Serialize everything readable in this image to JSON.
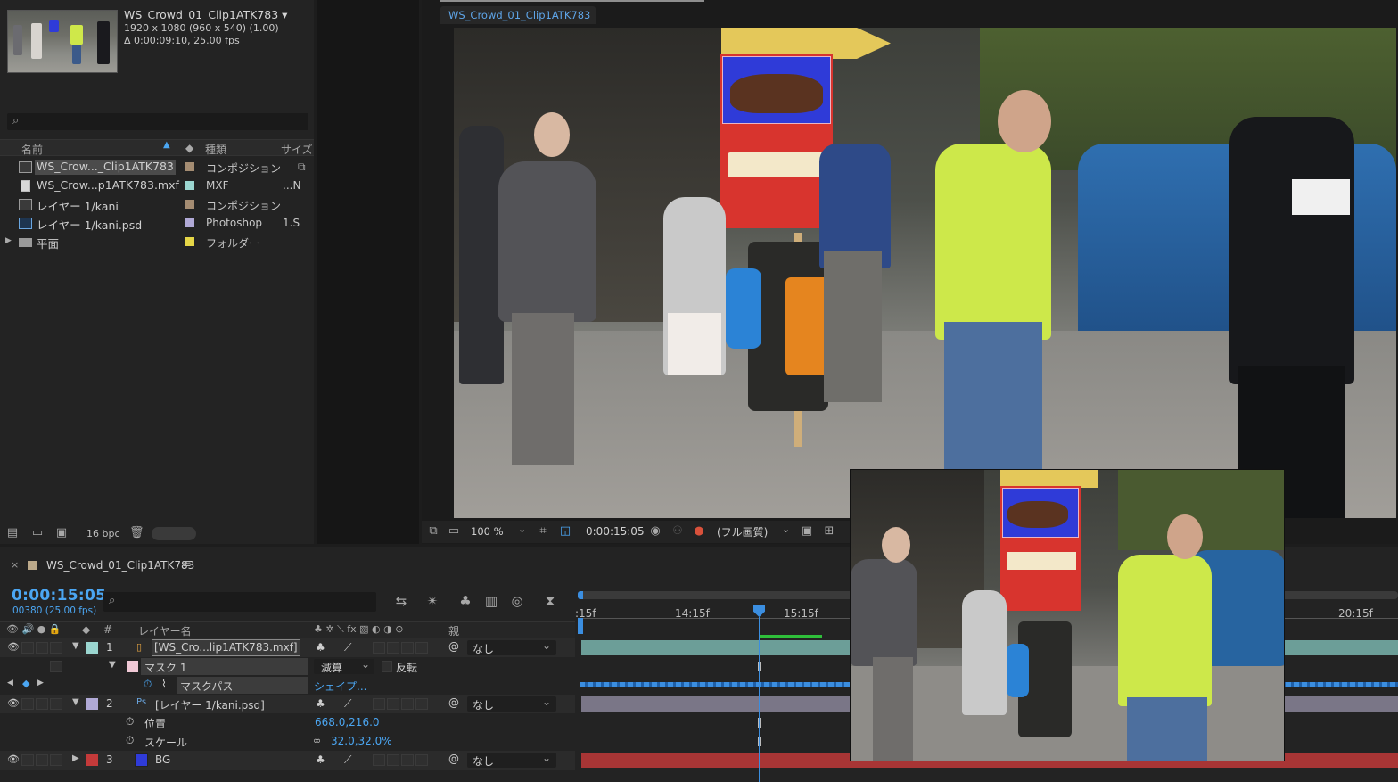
{
  "project": {
    "comp_name": "WS_Crowd_01_Clip1ATK783 ▾",
    "comp_dims": "1920 x 1080  (960 x 540) (1.00)",
    "comp_duration": "Δ 0:00:09:10, 25.00 fps",
    "search_placeholder": "",
    "columns": {
      "name": "名前",
      "type": "種類",
      "size": "サイズ"
    },
    "items": [
      {
        "name": "WS_Crow..._Clip1ATK783",
        "type": "コンポジション",
        "size": "",
        "label_color": "#a48c72",
        "icon": "composition-icon",
        "selected": true
      },
      {
        "name": "WS_Crow...p1ATK783.mxf",
        "type": "MXF",
        "size": "...N",
        "label_color": "#9bd6d0",
        "icon": "footage-icon",
        "selected": false
      },
      {
        "name": "レイヤー 1/kani",
        "type": "コンポジション",
        "size": "",
        "label_color": "#a48c72",
        "icon": "composition-icon",
        "selected": false
      },
      {
        "name": "レイヤー 1/kani.psd",
        "type": "Photoshop",
        "size": "1.S",
        "label_color": "#b0a9d6",
        "icon": "photoshop-icon",
        "selected": false
      },
      {
        "name": "平面",
        "type": "フォルダー",
        "size": "",
        "label_color": "#e5d647",
        "icon": "folder-icon",
        "selected": false
      }
    ],
    "bpc": "16 bpc"
  },
  "viewer": {
    "tab_name": "WS_Crowd_01_Clip1ATK783",
    "zoom": "100 %",
    "timecode": "0:00:15:05",
    "quality": "(フル画質)"
  },
  "timeline": {
    "comp_name": "WS_Crowd_01_Clip1ATK783",
    "current_time": "0:00:15:05",
    "frame_info": "00380 (25.00 fps)",
    "columns": {
      "layer_name": "レイヤー名",
      "number": "#",
      "parent": "親"
    },
    "ruler_ticks": [
      ":15f",
      "14:15f",
      "15:15f",
      "20:15f"
    ],
    "layers": [
      {
        "num": "1",
        "name": "[WS_Cro...lip1ATK783.mxf]",
        "label_color": "#9bd6d0",
        "parent": "なし"
      },
      {
        "num": "2",
        "name": "[レイヤー 1/kani.psd]",
        "label_color": "#b0a9d6",
        "parent": "なし"
      },
      {
        "num": "3",
        "name": "BG",
        "label_color": "#c43a3a",
        "parent": "なし",
        "swatch": "#2f3bd8"
      }
    ],
    "mask": {
      "name": "マスク 1",
      "mode": "減算",
      "invert": "反転",
      "path_label": "マスクパス",
      "path_value": "シェイプ..."
    },
    "position": {
      "label": "位置",
      "value": "668.0,216.0"
    },
    "scale": {
      "label": "スケール",
      "value": "32.0,32.0%"
    }
  }
}
